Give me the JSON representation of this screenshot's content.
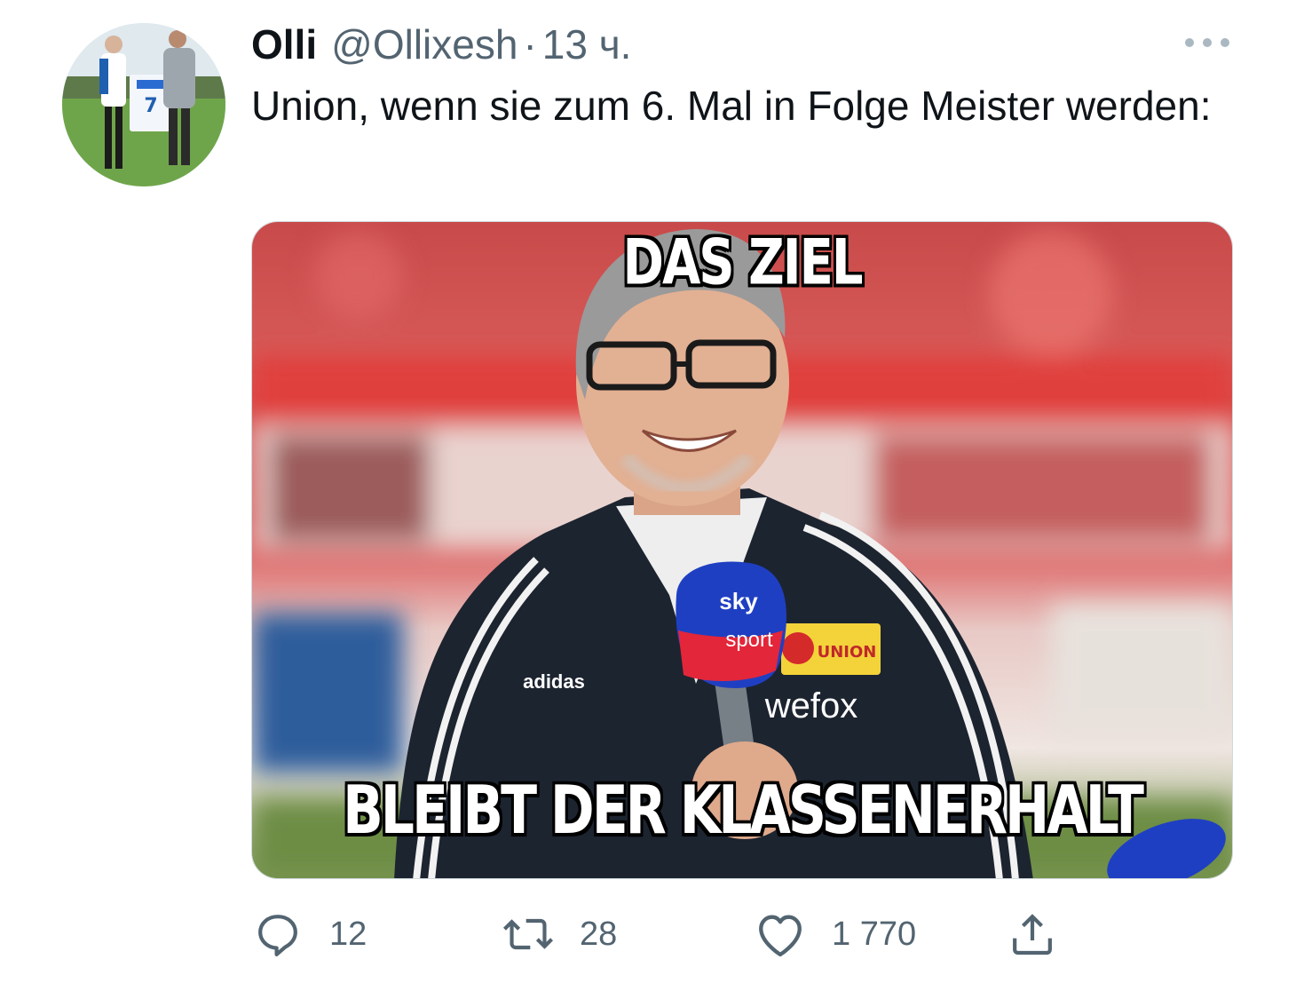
{
  "tweet": {
    "display_name": "Olli",
    "handle": "@Ollixesh",
    "separator": "·",
    "time": "13 ч.",
    "text": "Union, wenn sie zum 6. Mal in Folge Meister werden:",
    "more_icon": "more-horizontal-icon"
  },
  "media": {
    "top_caption": "DAS ZIEL",
    "bottom_caption": "BLEIBT DER KLASSENERHALT",
    "jacket_brand": "adidas",
    "sponsor": "wefox",
    "club_badge": "UNION",
    "mic_brand_1": "sky",
    "mic_brand_2": "sport"
  },
  "actions": {
    "reply": {
      "icon": "reply-icon",
      "count": "12"
    },
    "retweet": {
      "icon": "retweet-icon",
      "count": "28"
    },
    "like": {
      "icon": "heart-icon",
      "count": "1 770"
    },
    "share": {
      "icon": "share-icon"
    }
  },
  "colors": {
    "text": "#0f1419",
    "secondary": "#536471",
    "stadium_red": "#d9393b"
  }
}
